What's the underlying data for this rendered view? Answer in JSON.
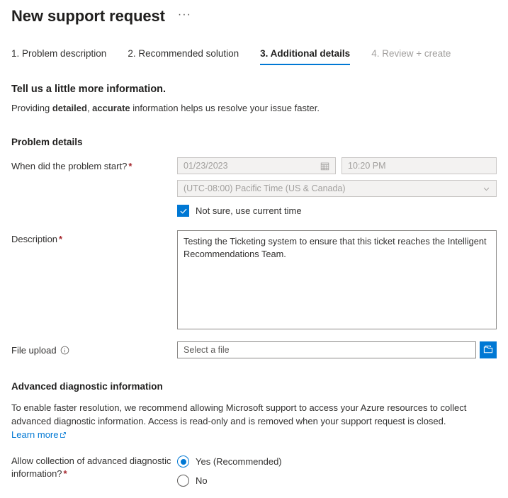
{
  "header": {
    "title": "New support request",
    "more_menu": "···"
  },
  "tabs": [
    {
      "label": "1. Problem description",
      "state": "complete"
    },
    {
      "label": "2. Recommended solution",
      "state": "complete"
    },
    {
      "label": "3. Additional details",
      "state": "active"
    },
    {
      "label": "4. Review + create",
      "state": "disabled"
    }
  ],
  "intro": {
    "heading": "Tell us a little more information.",
    "desc_part1": "Providing ",
    "desc_bold1": "detailed",
    "desc_part2": ", ",
    "desc_bold2": "accurate",
    "desc_part3": " information helps us resolve your issue faster."
  },
  "problem_details": {
    "section_title": "Problem details",
    "start_label": "When did the problem start?",
    "start_required": "*",
    "date_value": "01/23/2023",
    "time_value": "10:20 PM",
    "timezone_value": "(UTC-08:00) Pacific Time (US & Canada)",
    "not_sure_label": "Not sure, use current time",
    "not_sure_checked": "true",
    "description_label": "Description",
    "description_required": "*",
    "description_value": "Testing the Ticketing system to ensure that this ticket reaches the Intelligent Recommendations Team.",
    "file_upload_label": "File upload",
    "file_upload_placeholder": "Select a file",
    "file_upload_value": ""
  },
  "advanced": {
    "section_title": "Advanced diagnostic information",
    "paragraph_part1": "To enable faster resolution, we recommend allowing Microsoft support to access your Azure resources to collect advanced diagnostic information. Access is read-only and is removed when your support request is closed. ",
    "learn_more": "Learn more",
    "allow_label_line1": "Allow collection of advanced diagnostic",
    "allow_label_line2": "information?",
    "allow_required": "*",
    "options": [
      {
        "label": "Yes (Recommended)",
        "selected": "true"
      },
      {
        "label": "No",
        "selected": "false"
      }
    ]
  },
  "colors": {
    "accent": "#0078d4",
    "required": "#a4262c",
    "text": "#323130",
    "disabled_bg": "#f3f2f1",
    "border": "#8a8886"
  }
}
